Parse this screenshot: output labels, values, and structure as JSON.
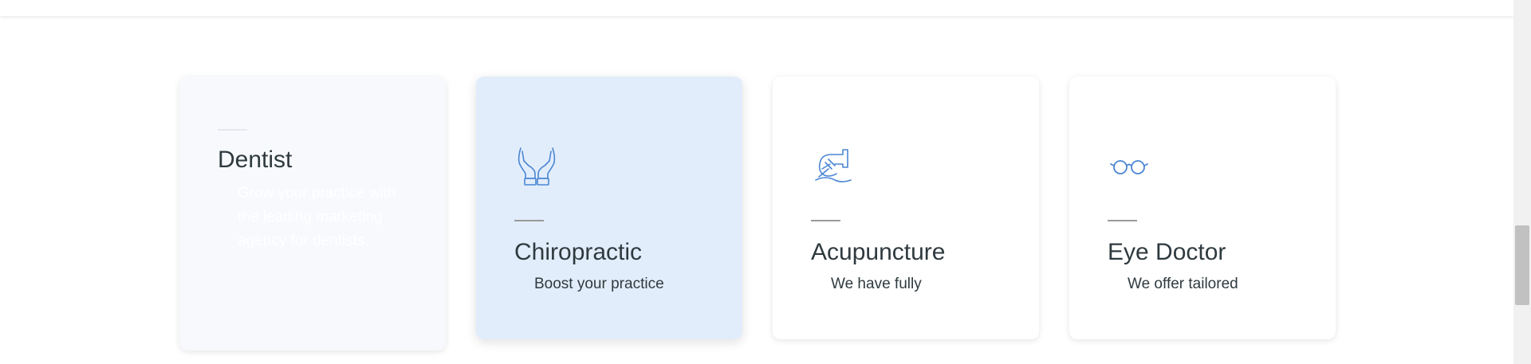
{
  "cards": [
    {
      "title": "Dentist",
      "description": "Grow your practice with the leading marketing agency for dentists.",
      "icon": "none"
    },
    {
      "title": "Chiropractic",
      "description": "Boost your practice",
      "icon": "hands-icon"
    },
    {
      "title": "Acupuncture",
      "description": "We have fully",
      "icon": "acupuncture-needle-icon"
    },
    {
      "title": "Eye Doctor",
      "description": "We offer tailored",
      "icon": "glasses-icon"
    }
  ],
  "colors": {
    "accent": "#4a86d4",
    "active_card_bg": "#e2edfb",
    "text": "#2f3a3f"
  }
}
